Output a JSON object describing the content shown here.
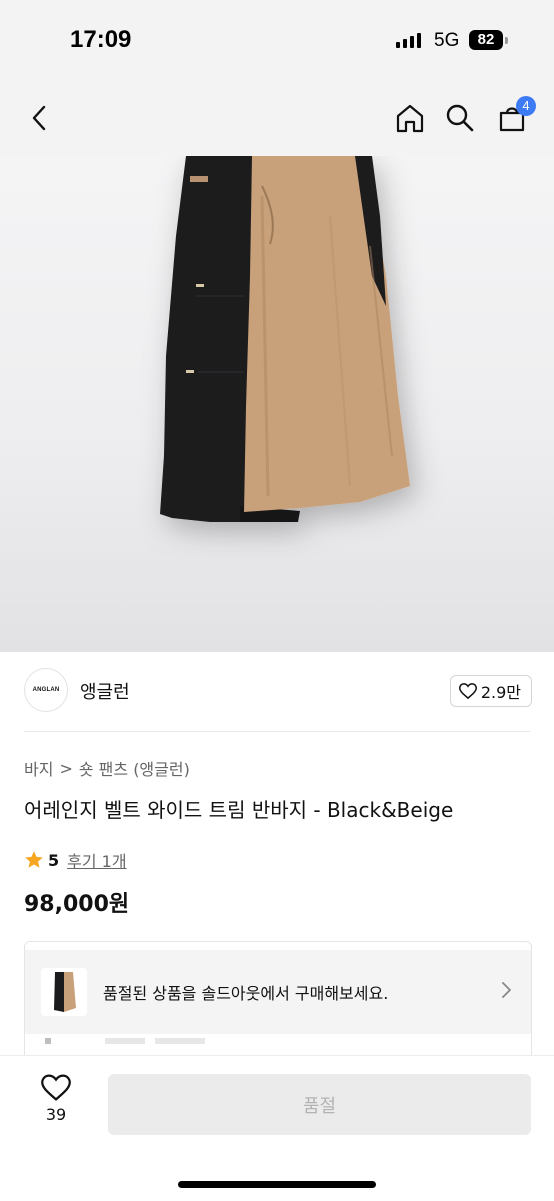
{
  "status_bar": {
    "time": "17:09",
    "network": "5G",
    "battery": "82"
  },
  "nav": {
    "cart_count": "4"
  },
  "product_image": {
    "alt_colors": {
      "left_panel": "#1a1a1c",
      "right_panel": "#c8a27c"
    }
  },
  "brand": {
    "logo_text": "ANGLAN",
    "name": "앵글런",
    "likes": "2.9만"
  },
  "breadcrumb": {
    "category": "바지",
    "separator": ">",
    "subcategory": "숏 팬츠 (앵글런)"
  },
  "product": {
    "title": "어레인지 벨트 와이드 트림 반바지 - Black&Beige",
    "rating": "5",
    "review_label": "후기 1개",
    "price": "98,000원"
  },
  "soldout": {
    "message": "품절된 상품을 솔드아웃에서 구매해보세요."
  },
  "bottom_bar": {
    "wish_count": "39",
    "buy_label": "품절"
  },
  "colors": {
    "accent_badge": "#3d7bf5",
    "star": "#f5a623"
  }
}
